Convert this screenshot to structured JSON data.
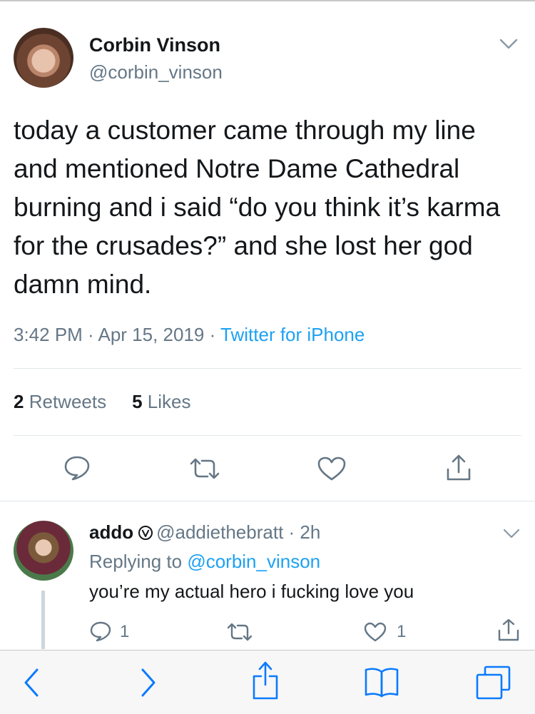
{
  "tweet": {
    "author_name": "Corbin Vinson",
    "author_handle": "@corbin_vinson",
    "text": "today a customer came through my line and mentioned Notre Dame Cathedral burning and i said “do you think it’s karma for the crusades?” and she lost her god damn mind.",
    "time": "3:42 PM",
    "date": "Apr 15, 2019",
    "source": "Twitter for iPhone",
    "separator": " · ",
    "retweets_count": "2",
    "retweets_label": "Retweets",
    "likes_count": "5",
    "likes_label": "Likes"
  },
  "reply": {
    "author_name": "addo",
    "author_handle": "@addiethebratt",
    "age": "2h",
    "replying_prefix": "Replying to",
    "replying_to": "@corbin_vinson",
    "text": "you’re my actual hero i fucking love you",
    "reply_count": "1",
    "like_count": "1"
  },
  "icons": {
    "reply": "speech-bubble-icon",
    "retweet": "retweet-icon",
    "like": "heart-icon",
    "share": "share-icon",
    "menu": "chevron-down-icon",
    "verified": "verified-badge-icon",
    "back": "back-arrow-icon",
    "forward": "forward-arrow-icon",
    "safari_share": "share-icon",
    "bookmarks": "book-icon",
    "tabs": "tabs-icon"
  },
  "colors": {
    "text": "#14171a",
    "secondary": "#657786",
    "link": "#1da1f2",
    "divider": "#e1e8ed",
    "safari_blue": "#0a7aff"
  }
}
